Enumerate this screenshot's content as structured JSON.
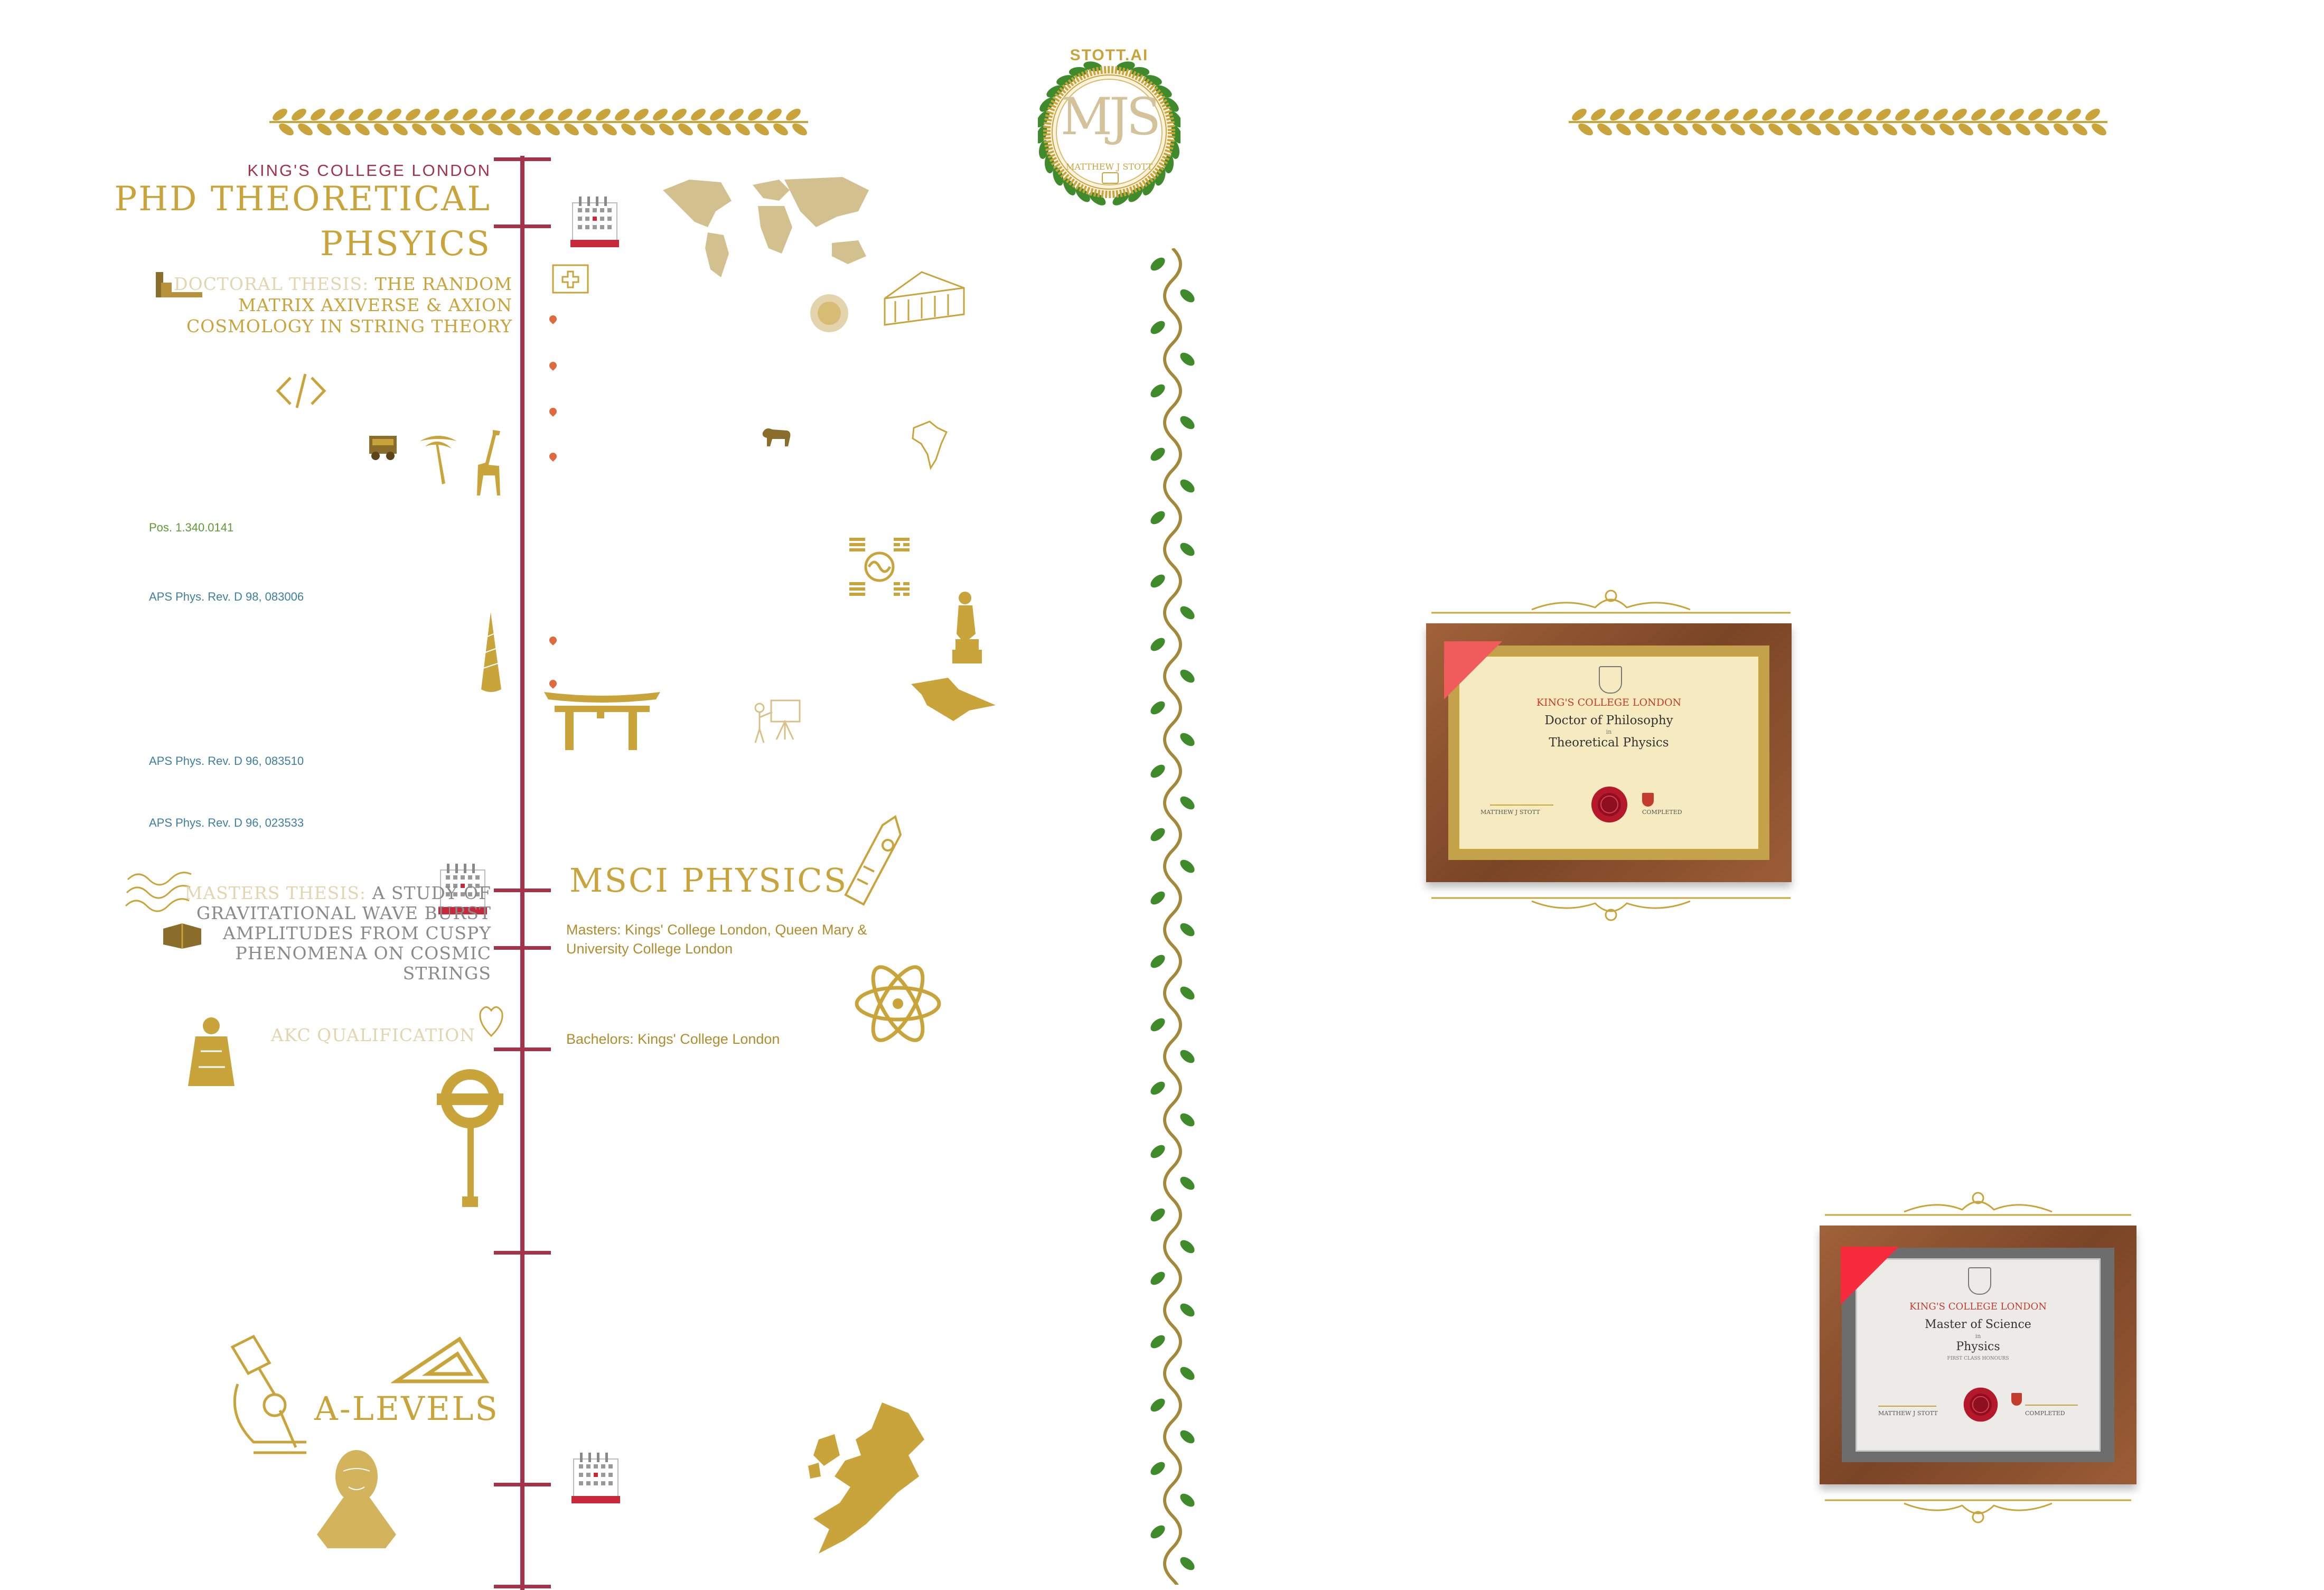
{
  "colors": {
    "gold": "#c9a43a",
    "burgundy": "#a3324a",
    "vine_green": "#3f8a2a",
    "frame_brown": "#8a5230",
    "seal_red": "#b5172b"
  },
  "logo": {
    "brand": "STOTT.AI",
    "monogram": "MJS",
    "name": "MATTHEW J STOTT"
  },
  "timeline": {
    "phd": {
      "institution": "KING'S COLLEGE LONDON",
      "title_line1": "PHD THEORETICAL",
      "title_line2": "PHSYICS",
      "thesis_label": "DOCTORAL THESIS:",
      "thesis_line1": "THE RANDOM",
      "thesis_line2": "MATRIX AXIVERSE & AXION",
      "thesis_line3": "COSMOLOGY IN STRING THEORY"
    },
    "publications": [
      "Pos. 1.340.0141",
      "APS Phys. Rev. D 98, 083006",
      "APS Phys. Rev. D 96, 083510",
      "APS Phys. Rev. D 96, 023533"
    ],
    "msci": {
      "title": "MSCI PHYSICS",
      "masters_line1": "Masters: Kings' College London, Queen Mary &",
      "masters_line2": "University College London",
      "bachelors": "Bachelors: Kings' College London",
      "thesis_label": "MASTERS THESIS:",
      "thesis_line1": "A STUDY OF",
      "thesis_line2": "GRAVITATIONAL WAVE BURST",
      "thesis_line3": "AMPLITUDES FROM CUSPY",
      "thesis_line4": "PHENOMENA ON COSMIC STRINGS",
      "akc": "AKC QUALIFICATION"
    },
    "alevels": {
      "title": "A-LEVELS"
    }
  },
  "certificates": [
    {
      "institution": "KING'S COLLEGE LONDON",
      "degree": "Doctor of Philosophy",
      "connector": "in",
      "subject": "Theoretical Physics",
      "signatory": "MATTHEW J STOTT",
      "status": "COMPLETED"
    },
    {
      "institution": "KING'S COLLEGE LONDON",
      "degree": "Master of Science",
      "connector": "in",
      "subject": "Physics",
      "honours": "FIRST CLASS HONOURS",
      "signatory": "MATTHEW J STOTT",
      "status": "COMPLETED"
    }
  ],
  "icons": [
    "laurel-garland-icon",
    "calendar-icon",
    "world-map-icon",
    "medical-cross-icon",
    "map-pin-icon",
    "code-icon",
    "jeep-icon",
    "palm-tree-icon",
    "giraffe-icon",
    "lion-icon",
    "africa-map-icon",
    "taegeuk-icon",
    "statue-icon",
    "unicorn-horn-icon",
    "torii-gate-icon",
    "teacher-icon",
    "big-ben-icon",
    "atom-icon",
    "waves-icon",
    "book-icon",
    "saint-icon",
    "underground-sign-icon",
    "microscope-icon",
    "set-square-icon",
    "bust-icon",
    "europe-map-icon",
    "vine-icon",
    "wax-seal-icon"
  ]
}
